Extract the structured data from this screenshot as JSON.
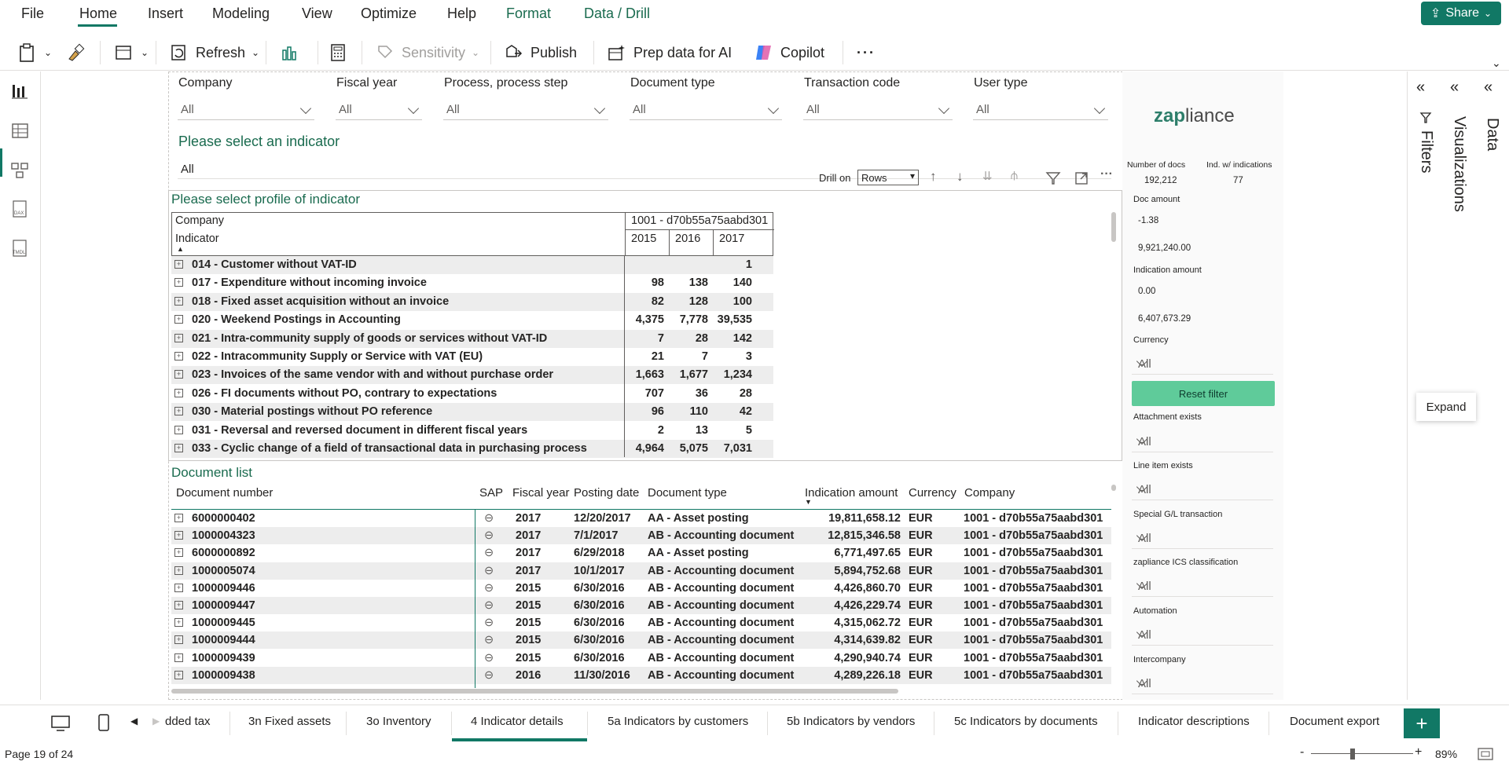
{
  "menu": {
    "items": [
      "File",
      "Home",
      "Insert",
      "Modeling",
      "View",
      "Optimize",
      "Help",
      "Format",
      "Data / Drill"
    ],
    "share_label": "Share"
  },
  "toolbar": {
    "refresh": "Refresh",
    "sensitivity": "Sensitivity",
    "publish": "Publish",
    "prep_ai": "Prep data for AI",
    "copilot": "Copilot",
    "more": "···"
  },
  "slicers": [
    {
      "label": "Company",
      "value": "All"
    },
    {
      "label": "Fiscal year",
      "value": "All"
    },
    {
      "label": "Process, process step",
      "value": "All"
    },
    {
      "label": "Document type",
      "value": "All"
    },
    {
      "label": "Transaction code",
      "value": "All"
    },
    {
      "label": "User type",
      "value": "All"
    }
  ],
  "indicator_select": {
    "title": "Please select an indicator",
    "value": "All"
  },
  "drill": {
    "label": "Drill on",
    "value": "Rows"
  },
  "profile": {
    "title": "Please select profile of indicator",
    "company_header": "Company",
    "company_value": "1001 - d70b55a75aabd301",
    "indicator_header": "Indicator",
    "years": [
      "2015",
      "2016",
      "2017"
    ],
    "rows": [
      {
        "label": "014 - Customer without VAT-ID",
        "v": [
          "",
          "",
          "1"
        ]
      },
      {
        "label": "017 - Expenditure without incoming invoice",
        "v": [
          "98",
          "138",
          "140"
        ]
      },
      {
        "label": "018 - Fixed asset acquisition without an invoice",
        "v": [
          "82",
          "128",
          "100"
        ]
      },
      {
        "label": "020 - Weekend Postings in Accounting",
        "v": [
          "4,375",
          "7,778",
          "39,535"
        ]
      },
      {
        "label": "021 - Intra-community supply of goods or services without VAT-ID",
        "v": [
          "7",
          "28",
          "142"
        ]
      },
      {
        "label": "022 - Intracommunity Supply or Service with VAT (EU)",
        "v": [
          "21",
          "7",
          "3"
        ]
      },
      {
        "label": "023 - Invoices of the same vendor with and without purchase order",
        "v": [
          "1,663",
          "1,677",
          "1,234"
        ]
      },
      {
        "label": "026 - FI documents without PO, contrary to expectations",
        "v": [
          "707",
          "36",
          "28"
        ]
      },
      {
        "label": "030 - Material postings without PO reference",
        "v": [
          "96",
          "110",
          "42"
        ]
      },
      {
        "label": "031 - Reversal and reversed document in different fiscal years",
        "v": [
          "2",
          "13",
          "5"
        ]
      },
      {
        "label": "033 - Cyclic change of a field of transactional data in purchasing process",
        "v": [
          "4,964",
          "5,075",
          "7,031"
        ]
      }
    ]
  },
  "doclist": {
    "title": "Document list",
    "headers": [
      "Document number",
      "SAP",
      "Fiscal year",
      "Posting date",
      "Document type",
      "Indication amount",
      "Currency",
      "Company"
    ],
    "rows": [
      [
        "6000000402",
        "2017",
        "12/20/2017",
        "AA - Asset posting",
        "19,811,658.12",
        "EUR",
        "1001 - d70b55a75aabd301"
      ],
      [
        "1000004323",
        "2017",
        "7/1/2017",
        "AB - Accounting document",
        "12,815,346.58",
        "EUR",
        "1001 - d70b55a75aabd301"
      ],
      [
        "6000000892",
        "2017",
        "6/29/2018",
        "AA - Asset posting",
        "6,771,497.65",
        "EUR",
        "1001 - d70b55a75aabd301"
      ],
      [
        "1000005074",
        "2017",
        "10/1/2017",
        "AB - Accounting document",
        "5,894,752.68",
        "EUR",
        "1001 - d70b55a75aabd301"
      ],
      [
        "1000009446",
        "2015",
        "6/30/2016",
        "AB - Accounting document",
        "4,426,860.70",
        "EUR",
        "1001 - d70b55a75aabd301"
      ],
      [
        "1000009447",
        "2015",
        "6/30/2016",
        "AB - Accounting document",
        "4,426,229.74",
        "EUR",
        "1001 - d70b55a75aabd301"
      ],
      [
        "1000009445",
        "2015",
        "6/30/2016",
        "AB - Accounting document",
        "4,315,062.72",
        "EUR",
        "1001 - d70b55a75aabd301"
      ],
      [
        "1000009444",
        "2015",
        "6/30/2016",
        "AB - Accounting document",
        "4,314,639.82",
        "EUR",
        "1001 - d70b55a75aabd301"
      ],
      [
        "1000009439",
        "2015",
        "6/30/2016",
        "AB - Accounting document",
        "4,290,940.74",
        "EUR",
        "1001 - d70b55a75aabd301"
      ],
      [
        "1000009438",
        "2016",
        "11/30/2016",
        "AB - Accounting document",
        "4,289,226.18",
        "EUR",
        "1001 - d70b55a75aabd301"
      ]
    ]
  },
  "rpanel": {
    "logo": "zapliance",
    "num_docs_label": "Number of docs",
    "num_docs": "192,212",
    "ind_label": "Ind. w/ indications",
    "ind_value": "77",
    "doc_amount_label": "Doc amount",
    "doc_amount_min": "-1.38",
    "doc_amount_max": "9,921,240.00",
    "ind_amount_label": "Indication amount",
    "ind_amount_min": "0.00",
    "ind_amount_max": "6,407,673.29",
    "currency_label": "Currency",
    "currency_value": "All",
    "reset": "Reset filter",
    "filters": [
      {
        "label": "Attachment exists",
        "value": "All"
      },
      {
        "label": "Line item exists",
        "value": "All"
      },
      {
        "label": "Special G/L transaction",
        "value": "All"
      },
      {
        "label": "zapliance ICS classification",
        "value": "All"
      },
      {
        "label": "Automation",
        "value": "All"
      },
      {
        "label": "Intercompany",
        "value": "All"
      }
    ]
  },
  "panes": {
    "filters": "Filters",
    "visualizations": "Visualizations",
    "data": "Data",
    "expand_tooltip": "Expand"
  },
  "tabs": [
    "dded tax",
    "3n Fixed assets",
    "3o Inventory",
    "4 Indicator details",
    "5a Indicators by customers",
    "5b Indicators by vendors",
    "5c Indicators by documents",
    "Indicator descriptions",
    "Document export"
  ],
  "status": {
    "page": "Page 19 of 24",
    "zoom": "89%"
  },
  "colors": {
    "accent": "#117865",
    "reset_btn": "#5fcb9a"
  }
}
